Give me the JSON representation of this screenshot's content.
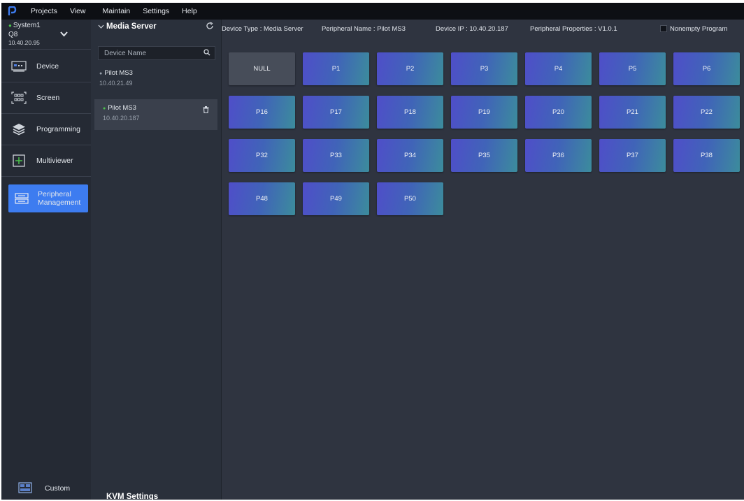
{
  "menubar": {
    "items": [
      "Projects",
      "View",
      "Maintain",
      "Settings",
      "Help"
    ]
  },
  "system": {
    "name": "System1",
    "model": "Q8",
    "ip": "10.40.20.95"
  },
  "nav": {
    "items": [
      {
        "label": "Device",
        "icon": "device-icon"
      },
      {
        "label": "Screen",
        "icon": "screen-icon"
      },
      {
        "label": "Programming",
        "icon": "layers-icon"
      },
      {
        "label": "Multiviewer",
        "icon": "multiviewer-icon"
      },
      {
        "label": "Peripheral Management",
        "icon": "peripheral-icon"
      }
    ],
    "custom_label": "Custom"
  },
  "list": {
    "title": "Media Server",
    "search_placeholder": "Device Name",
    "devices": [
      {
        "name": "Pilot MS3",
        "ip": "10.40.21.49",
        "status_color": "#9aa2ad"
      },
      {
        "name": "Pilot MS3",
        "ip": "10.40.20.187",
        "status_color": "#4cc34c"
      }
    ],
    "kvm_label": "KVM Settings"
  },
  "info": {
    "device_type": "Device Type : Media Server",
    "peripheral_name": "Peripheral Name : Pilot MS3",
    "device_ip": "Device IP : 10.40.20.187",
    "properties": "Peripheral Properties : V1.0.1",
    "nonempty": "Nonempty Program"
  },
  "programs": [
    "NULL",
    "P1",
    "P2",
    "P3",
    "P4",
    "P5",
    "P6",
    "P16",
    "P17",
    "P18",
    "P19",
    "P20",
    "P21",
    "P22",
    "P32",
    "P33",
    "P34",
    "P35",
    "P36",
    "P37",
    "P38",
    "P48",
    "P49",
    "P50"
  ],
  "colors": {
    "accent": "#3d7cf0",
    "online": "#4cc34c"
  }
}
